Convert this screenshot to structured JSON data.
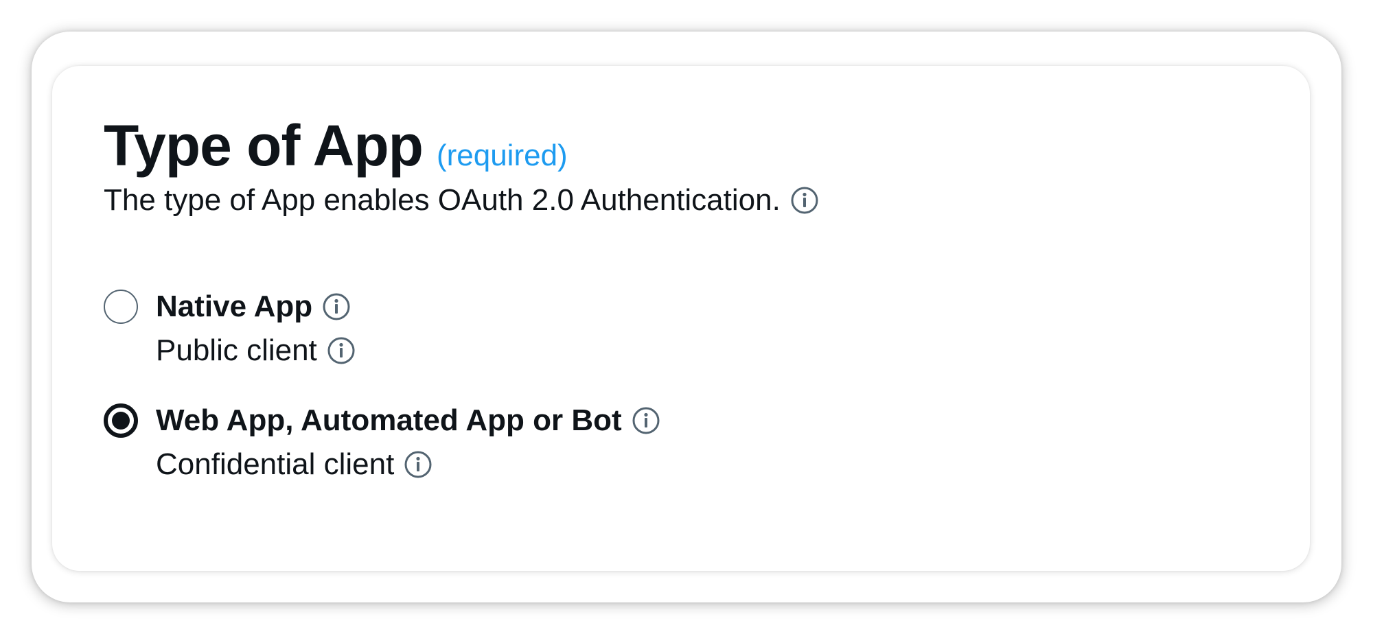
{
  "form": {
    "title": "Type of App",
    "required_label": "(required)",
    "description": "The type of App enables OAuth 2.0 Authentication."
  },
  "options": [
    {
      "label": "Native App",
      "sublabel": "Public client",
      "selected": false
    },
    {
      "label": "Web App, Automated App or Bot",
      "sublabel": "Confidential client",
      "selected": true
    }
  ],
  "icons": {
    "info": "info-circle-icon",
    "radio_unselected": "radio-unselected",
    "radio_selected": "radio-selected"
  },
  "colors": {
    "text": "#0f1419",
    "accent": "#1d9bf0",
    "icon": "#536471"
  }
}
